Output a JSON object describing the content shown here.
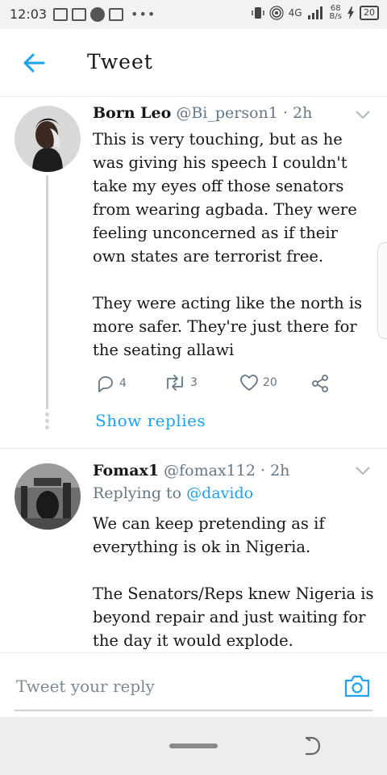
{
  "status_bar": {
    "time": "12:03",
    "network_label": "4G",
    "speed_value": "68",
    "speed_unit": "B/s",
    "battery": "20"
  },
  "header": {
    "title": "Tweet"
  },
  "tweets": [
    {
      "name": "Born Leo",
      "handle": "@Bi_person1",
      "time": "2h",
      "paragraphs": [
        "This is very touching, but as he was giving his speech I couldn't take my eyes off those senators from wearing agbada. They were feeling unconcerned as if their own states are terrorist free.",
        "They were acting like the north is more safer. They're just there for the seating allawi"
      ],
      "replies": "4",
      "retweets": "3",
      "likes": "20",
      "show_replies": "Show replies"
    },
    {
      "name": "Fomax1",
      "handle": "@fomax112",
      "time": "2h",
      "replying_prefix": "Replying to",
      "replying_to": "@davido",
      "paragraphs": [
        "We can keep pretending as if everything is ok in Nigeria.",
        "The Senators/Reps knew Nigeria is beyond repair and just waiting for the day it would explode."
      ]
    }
  ],
  "composer": {
    "placeholder": "Tweet your reply"
  },
  "colors": {
    "accent": "#1da1f2",
    "secondary_text": "#657786",
    "divider": "#e6ecf0"
  }
}
